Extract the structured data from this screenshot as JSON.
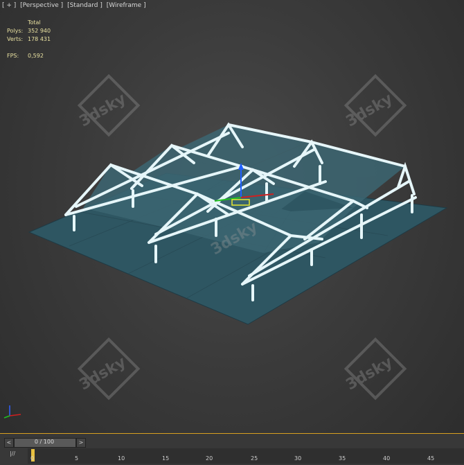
{
  "viewport": {
    "labels": [
      "[ + ]",
      "[Perspective ]",
      "[Standard ]",
      "[Wireframe ]"
    ]
  },
  "stats": {
    "header": "Total",
    "polys_label": "Polys:",
    "polys_value": "352 940",
    "verts_label": "Verts:",
    "verts_value": "178 431",
    "fps_label": "FPS:",
    "fps_value": "0,592"
  },
  "watermark": "3dsky",
  "timeline": {
    "slider_text": "0 / 100",
    "prev": "<",
    "next": ">",
    "icon": "|//",
    "ticks": [
      "0",
      "5",
      "10",
      "15",
      "20",
      "25",
      "30",
      "35",
      "40",
      "45"
    ]
  },
  "colors": {
    "frame": "#dff4f8",
    "ground": "#2f5763",
    "panel": "#3c6470"
  }
}
